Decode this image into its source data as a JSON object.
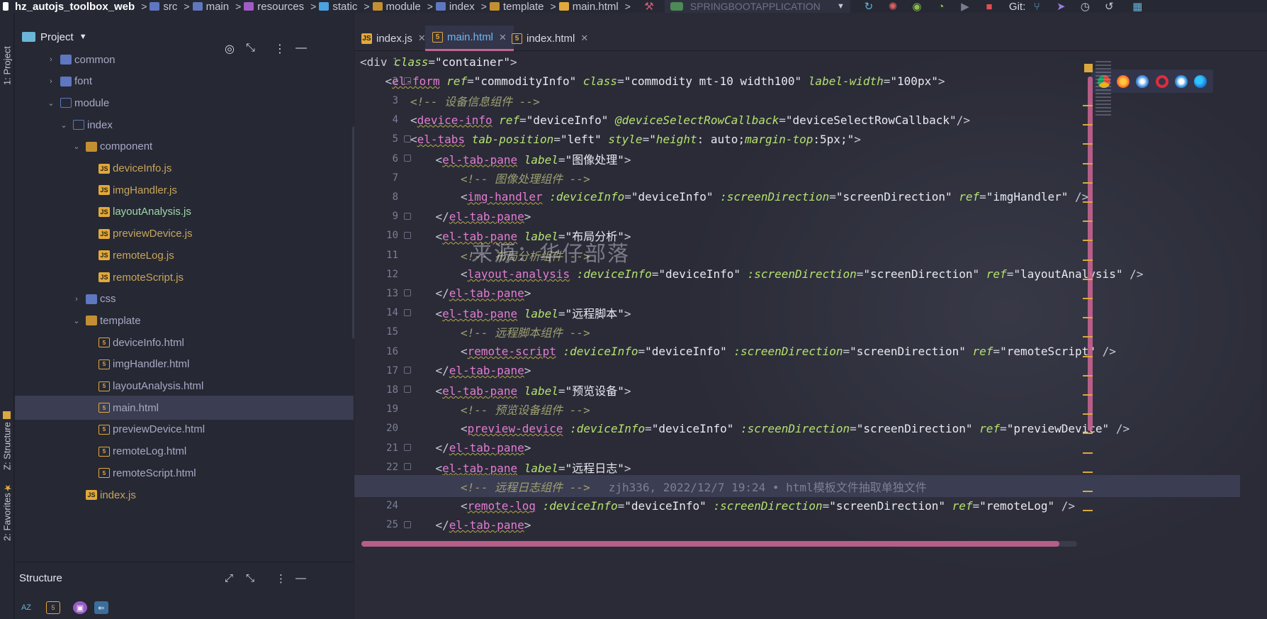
{
  "navbar": {
    "crumbs": [
      {
        "label": "hz_autojs_toolbox_web",
        "icon": "project-icon",
        "color": "#ffffff"
      },
      {
        "label": "src",
        "icon": "source-folder-icon",
        "color": "#5e77c0"
      },
      {
        "label": "main",
        "icon": "folder-icon",
        "color": "#5e77c0"
      },
      {
        "label": "resources",
        "icon": "resources-folder-icon",
        "color": "#a05cc4"
      },
      {
        "label": "static",
        "icon": "web-folder-icon",
        "color": "#4aa2e0"
      },
      {
        "label": "module",
        "icon": "folder-icon",
        "color": "#c48f32"
      },
      {
        "label": "index",
        "icon": "folder-icon",
        "color": "#5e77c0"
      },
      {
        "label": "template",
        "icon": "folder-icon",
        "color": "#c48f32"
      },
      {
        "label": "main.html",
        "icon": "html-file-icon",
        "color": "#e2a93a"
      }
    ],
    "run_config": "SPRINGBOOTAPPLICATION",
    "git_label": "Git:"
  },
  "toolstrip": {
    "project_tab": "1: Project",
    "structure_tab": "Z: Structure",
    "favorites_tab": "2: Favorites"
  },
  "project": {
    "title": "Project",
    "tree": [
      {
        "label": "common",
        "type": "folder",
        "depth": 2,
        "arrow": "closed",
        "lbl": "lbl-html"
      },
      {
        "label": "font",
        "type": "folder",
        "depth": 2,
        "arrow": "closed",
        "lbl": "lbl-html"
      },
      {
        "label": "module",
        "type": "folder-open",
        "depth": 2,
        "arrow": "open",
        "lbl": "lbl-html"
      },
      {
        "label": "index",
        "type": "folder-open",
        "depth": 3,
        "arrow": "open",
        "lbl": "lbl-html"
      },
      {
        "label": "component",
        "type": "folder-res",
        "depth": 4,
        "arrow": "open",
        "lbl": "lbl-html"
      },
      {
        "label": "deviceInfo.js",
        "type": "js",
        "depth": 5,
        "arrow": "",
        "lbl": "lbl-js"
      },
      {
        "label": "imgHandler.js",
        "type": "js",
        "depth": 5,
        "arrow": "",
        "lbl": "lbl-js"
      },
      {
        "label": "layoutAnalysis.js",
        "type": "js",
        "depth": 5,
        "arrow": "",
        "lbl": "lbl-hl"
      },
      {
        "label": "previewDevice.js",
        "type": "js",
        "depth": 5,
        "arrow": "",
        "lbl": "lbl-js"
      },
      {
        "label": "remoteLog.js",
        "type": "js",
        "depth": 5,
        "arrow": "",
        "lbl": "lbl-js"
      },
      {
        "label": "remoteScript.js",
        "type": "js",
        "depth": 5,
        "arrow": "",
        "lbl": "lbl-js"
      },
      {
        "label": "css",
        "type": "folder",
        "depth": 4,
        "arrow": "closed",
        "lbl": "lbl-html"
      },
      {
        "label": "template",
        "type": "folder-res",
        "depth": 4,
        "arrow": "open",
        "lbl": "lbl-html"
      },
      {
        "label": "deviceInfo.html",
        "type": "html",
        "depth": 5,
        "arrow": "",
        "lbl": "lbl-html"
      },
      {
        "label": "imgHandler.html",
        "type": "html",
        "depth": 5,
        "arrow": "",
        "lbl": "lbl-html"
      },
      {
        "label": "layoutAnalysis.html",
        "type": "html",
        "depth": 5,
        "arrow": "",
        "lbl": "lbl-html"
      },
      {
        "label": "main.html",
        "type": "html",
        "depth": 5,
        "arrow": "",
        "lbl": "lbl-html",
        "selected": true
      },
      {
        "label": "previewDevice.html",
        "type": "html",
        "depth": 5,
        "arrow": "",
        "lbl": "lbl-html"
      },
      {
        "label": "remoteLog.html",
        "type": "html",
        "depth": 5,
        "arrow": "",
        "lbl": "lbl-html"
      },
      {
        "label": "remoteScript.html",
        "type": "html",
        "depth": 5,
        "arrow": "",
        "lbl": "lbl-html"
      },
      {
        "label": "index.js",
        "type": "js",
        "depth": 4,
        "arrow": "",
        "lbl": "lbl-js"
      }
    ]
  },
  "structure": {
    "title": "Structure"
  },
  "editor": {
    "tabs": [
      {
        "label": "index.js",
        "icon": "js",
        "active": false
      },
      {
        "label": "main.html",
        "icon": "html",
        "active": true
      },
      {
        "label": "index.html",
        "icon": "html",
        "active": false
      }
    ],
    "watermark": "来源：华仔部落",
    "current_line": 23,
    "lines": [
      {
        "n": "1",
        "indent": 0,
        "toks": [
          [
            "brk",
            "<"
          ],
          [
            "brk",
            "div "
          ],
          [
            "attr",
            "class"
          ],
          [
            "brk",
            "="
          ],
          [
            "str",
            "\"container\""
          ],
          [
            "brk",
            ">"
          ]
        ]
      },
      {
        "n": "2",
        "indent": 1,
        "toks": [
          [
            "brk",
            "<"
          ],
          [
            "tag",
            "el-form"
          ],
          [
            "brk",
            " "
          ],
          [
            "attr",
            "ref"
          ],
          [
            "brk",
            "="
          ],
          [
            "str",
            "\"commodityInfo\" "
          ],
          [
            "attr",
            "class"
          ],
          [
            "brk",
            "="
          ],
          [
            "str",
            "\"commodity mt-10 width100\" "
          ],
          [
            "attr",
            "label-width"
          ],
          [
            "brk",
            "="
          ],
          [
            "str",
            "\"100px\""
          ],
          [
            "brk",
            ">"
          ]
        ]
      },
      {
        "n": "3",
        "indent": 2,
        "toks": [
          [
            "cmt",
            "<!-- 设备信息组件 -->"
          ]
        ]
      },
      {
        "n": "4",
        "indent": 2,
        "toks": [
          [
            "brk",
            "<"
          ],
          [
            "tag",
            "device-info"
          ],
          [
            "brk",
            " "
          ],
          [
            "attr",
            "ref"
          ],
          [
            "brk",
            "="
          ],
          [
            "str",
            "\"deviceInfo\" "
          ],
          [
            "attr",
            "@deviceSelectRowCallback"
          ],
          [
            "brk",
            "="
          ],
          [
            "str",
            "\"deviceSelectRowCallback\""
          ],
          [
            "brk",
            "/>"
          ]
        ]
      },
      {
        "n": "5",
        "indent": 2,
        "toks": [
          [
            "brk",
            "<"
          ],
          [
            "tag",
            "el-tabs"
          ],
          [
            "brk",
            " "
          ],
          [
            "attr",
            "tab-position"
          ],
          [
            "brk",
            "="
          ],
          [
            "str",
            "\"left\" "
          ],
          [
            "attr",
            "style"
          ],
          [
            "brk",
            "="
          ],
          [
            "str",
            "\""
          ],
          [
            "attr",
            "height"
          ],
          [
            "str",
            ": auto;"
          ],
          [
            "attr",
            "margin-top"
          ],
          [
            "str",
            ":5px;\""
          ],
          [
            "brk",
            ">"
          ]
        ]
      },
      {
        "n": "6",
        "indent": 3,
        "toks": [
          [
            "brk",
            "<"
          ],
          [
            "tag",
            "el-tab-pane"
          ],
          [
            "brk",
            " "
          ],
          [
            "attr",
            "label"
          ],
          [
            "brk",
            "="
          ],
          [
            "str",
            "\"图像处理\""
          ],
          [
            "brk",
            ">"
          ]
        ]
      },
      {
        "n": "7",
        "indent": 4,
        "toks": [
          [
            "cmt",
            "<!-- 图像处理组件 -->"
          ]
        ]
      },
      {
        "n": "8",
        "indent": 4,
        "toks": [
          [
            "brk",
            "<"
          ],
          [
            "tag",
            "img-handler"
          ],
          [
            "brk",
            " "
          ],
          [
            "attr",
            ":deviceInfo"
          ],
          [
            "brk",
            "="
          ],
          [
            "str",
            "\"deviceInfo\" "
          ],
          [
            "attr",
            ":screenDirection"
          ],
          [
            "brk",
            "="
          ],
          [
            "str",
            "\"screenDirection\" "
          ],
          [
            "attr",
            "ref"
          ],
          [
            "brk",
            "="
          ],
          [
            "str",
            "\"imgHandler\" "
          ],
          [
            "brk",
            "/>"
          ]
        ]
      },
      {
        "n": "9",
        "indent": 3,
        "toks": [
          [
            "brk",
            "</"
          ],
          [
            "tag",
            "el-tab-pane"
          ],
          [
            "brk",
            ">"
          ]
        ]
      },
      {
        "n": "10",
        "indent": 3,
        "toks": [
          [
            "brk",
            "<"
          ],
          [
            "tag",
            "el-tab-pane"
          ],
          [
            "brk",
            " "
          ],
          [
            "attr",
            "label"
          ],
          [
            "brk",
            "="
          ],
          [
            "str",
            "\"布局分析\""
          ],
          [
            "brk",
            ">"
          ]
        ]
      },
      {
        "n": "11",
        "indent": 4,
        "toks": [
          [
            "cmt",
            "<!-- 布局分析组件 -->"
          ]
        ]
      },
      {
        "n": "12",
        "indent": 4,
        "toks": [
          [
            "brk",
            "<"
          ],
          [
            "tag",
            "layout-analysis"
          ],
          [
            "brk",
            " "
          ],
          [
            "attr",
            ":deviceInfo"
          ],
          [
            "brk",
            "="
          ],
          [
            "str",
            "\"deviceInfo\" "
          ],
          [
            "attr",
            ":screenDirection"
          ],
          [
            "brk",
            "="
          ],
          [
            "str",
            "\"screenDirection\" "
          ],
          [
            "attr",
            "ref"
          ],
          [
            "brk",
            "="
          ],
          [
            "str",
            "\"layoutAnalysis\" "
          ],
          [
            "brk",
            "/>"
          ]
        ]
      },
      {
        "n": "13",
        "indent": 3,
        "toks": [
          [
            "brk",
            "</"
          ],
          [
            "tag",
            "el-tab-pane"
          ],
          [
            "brk",
            ">"
          ]
        ]
      },
      {
        "n": "14",
        "indent": 3,
        "toks": [
          [
            "brk",
            "<"
          ],
          [
            "tag",
            "el-tab-pane"
          ],
          [
            "brk",
            " "
          ],
          [
            "attr",
            "label"
          ],
          [
            "brk",
            "="
          ],
          [
            "str",
            "\"远程脚本\""
          ],
          [
            "brk",
            ">"
          ]
        ]
      },
      {
        "n": "15",
        "indent": 4,
        "toks": [
          [
            "cmt",
            "<!-- 远程脚本组件 -->"
          ]
        ]
      },
      {
        "n": "16",
        "indent": 4,
        "toks": [
          [
            "brk",
            "<"
          ],
          [
            "tag",
            "remote-script"
          ],
          [
            "brk",
            " "
          ],
          [
            "attr",
            ":deviceInfo"
          ],
          [
            "brk",
            "="
          ],
          [
            "str",
            "\"deviceInfo\" "
          ],
          [
            "attr",
            ":screenDirection"
          ],
          [
            "brk",
            "="
          ],
          [
            "str",
            "\"screenDirection\" "
          ],
          [
            "attr",
            "ref"
          ],
          [
            "brk",
            "="
          ],
          [
            "str",
            "\"remoteScript\" "
          ],
          [
            "brk",
            "/>"
          ]
        ]
      },
      {
        "n": "17",
        "indent": 3,
        "toks": [
          [
            "brk",
            "</"
          ],
          [
            "tag",
            "el-tab-pane"
          ],
          [
            "brk",
            ">"
          ]
        ]
      },
      {
        "n": "18",
        "indent": 3,
        "toks": [
          [
            "brk",
            "<"
          ],
          [
            "tag",
            "el-tab-pane"
          ],
          [
            "brk",
            " "
          ],
          [
            "attr",
            "label"
          ],
          [
            "brk",
            "="
          ],
          [
            "str",
            "\"预览设备\""
          ],
          [
            "brk",
            ">"
          ]
        ]
      },
      {
        "n": "19",
        "indent": 4,
        "toks": [
          [
            "cmt",
            "<!-- 预览设备组件 -->"
          ]
        ]
      },
      {
        "n": "20",
        "indent": 4,
        "toks": [
          [
            "brk",
            "<"
          ],
          [
            "tag",
            "preview-device"
          ],
          [
            "brk",
            " "
          ],
          [
            "attr",
            ":deviceInfo"
          ],
          [
            "brk",
            "="
          ],
          [
            "str",
            "\"deviceInfo\" "
          ],
          [
            "attr",
            ":screenDirection"
          ],
          [
            "brk",
            "="
          ],
          [
            "str",
            "\"screenDirection\" "
          ],
          [
            "attr",
            "ref"
          ],
          [
            "brk",
            "="
          ],
          [
            "str",
            "\"previewDevice\" "
          ],
          [
            "brk",
            "/>"
          ]
        ]
      },
      {
        "n": "21",
        "indent": 3,
        "toks": [
          [
            "brk",
            "</"
          ],
          [
            "tag",
            "el-tab-pane"
          ],
          [
            "brk",
            ">"
          ]
        ]
      },
      {
        "n": "22",
        "indent": 3,
        "toks": [
          [
            "brk",
            "<"
          ],
          [
            "tag",
            "el-tab-pane"
          ],
          [
            "brk",
            " "
          ],
          [
            "attr",
            "label"
          ],
          [
            "brk",
            "="
          ],
          [
            "str",
            "\"远程日志\""
          ],
          [
            "brk",
            ">"
          ]
        ]
      },
      {
        "n": "23",
        "indent": 4,
        "toks": [
          [
            "cmt",
            "<!-- 远程日志组件 -->"
          ]
        ],
        "blame": "zjh336, 2022/12/7 19:24 • html模板文件抽取单独文件"
      },
      {
        "n": "24",
        "indent": 4,
        "toks": [
          [
            "brk",
            "<"
          ],
          [
            "tag",
            "remote-log"
          ],
          [
            "brk",
            " "
          ],
          [
            "attr",
            ":deviceInfo"
          ],
          [
            "brk",
            "="
          ],
          [
            "str",
            "\"deviceInfo\" "
          ],
          [
            "attr",
            ":screenDirection"
          ],
          [
            "brk",
            "="
          ],
          [
            "str",
            "\"screenDirection\" "
          ],
          [
            "attr",
            "ref"
          ],
          [
            "brk",
            "="
          ],
          [
            "str",
            "\"remoteLog\" "
          ],
          [
            "brk",
            "/>"
          ]
        ]
      },
      {
        "n": "25",
        "indent": 3,
        "toks": [
          [
            "brk",
            "</"
          ],
          [
            "tag",
            "el-tab-pane"
          ],
          [
            "brk",
            ">"
          ]
        ]
      }
    ]
  },
  "colors": {
    "accent": "#c4638f",
    "tag": "#e37dd1",
    "attr": "#b6e26f",
    "comment": "#9ea06f",
    "marker": "#d9a940"
  }
}
